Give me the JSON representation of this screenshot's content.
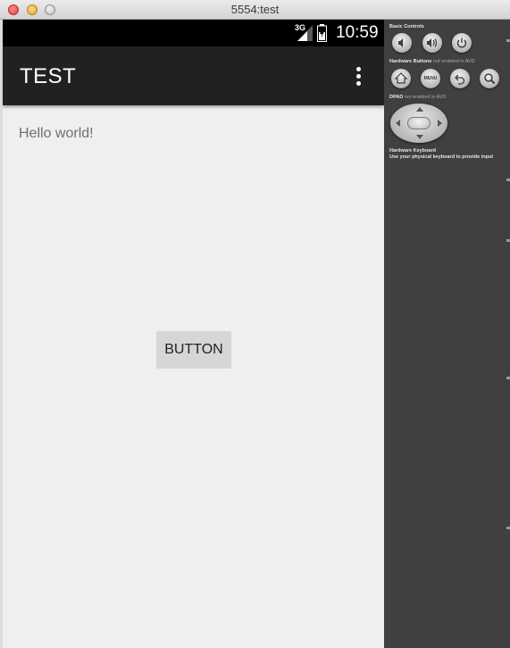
{
  "window": {
    "title": "5554:test"
  },
  "statusbar": {
    "network": "3G",
    "time": "10:59"
  },
  "actionbar": {
    "title": "TEST"
  },
  "content": {
    "hello_text": "Hello world!",
    "button_label": "BUTTON"
  },
  "controls": {
    "basic_label": "Basic Controls",
    "hardware_label": "Hardware Buttons",
    "hardware_note": "not enabled in AVD",
    "menu_label": "MENU",
    "dpad_label": "DPAD",
    "dpad_note": "not enabled in AVD",
    "keyboard_label": "Hardware Keyboard",
    "keyboard_note": "Use your physical keyboard to provide input"
  }
}
